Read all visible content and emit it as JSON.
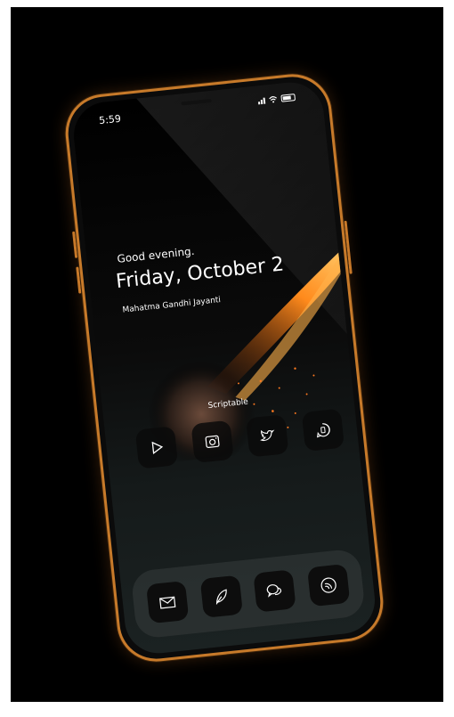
{
  "status_bar": {
    "time": "5:59"
  },
  "greeting": "Good evening.",
  "date_line": "Friday, October 2",
  "holiday": "Mahatma Gandhi Jayanti",
  "widget_label": "Scriptable",
  "home_apps": [
    {
      "icon": "play-icon"
    },
    {
      "icon": "camera-icon"
    },
    {
      "icon": "bird-icon"
    },
    {
      "icon": "message-phone-icon"
    }
  ],
  "dock_apps": [
    {
      "icon": "mail-icon"
    },
    {
      "icon": "leaf-icon"
    },
    {
      "icon": "chat-bubbles-icon"
    },
    {
      "icon": "rss-circle-icon"
    }
  ],
  "colors": {
    "phone_frame": "#c77a2a",
    "background": "#000000",
    "flame": "#ff8a1c"
  }
}
